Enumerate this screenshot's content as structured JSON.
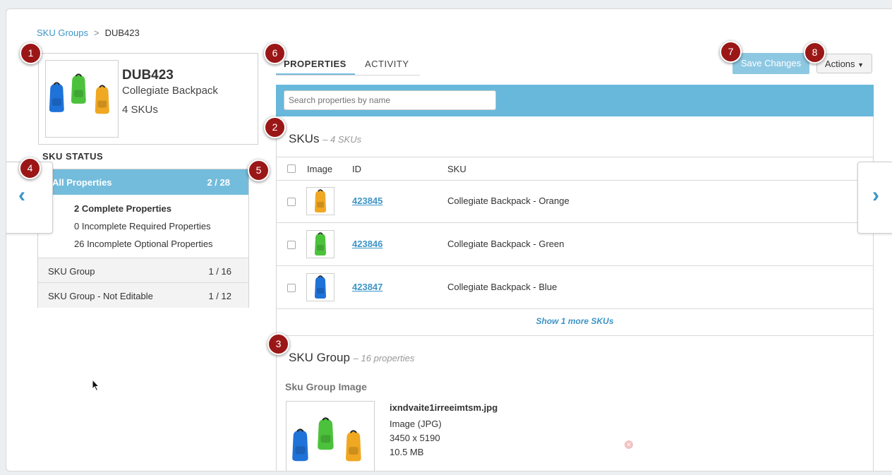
{
  "breadcrumb": {
    "parent": "SKU Groups",
    "separator": ">",
    "current": "DUB423"
  },
  "product": {
    "id": "DUB423",
    "name": "Collegiate Backpack",
    "sku_count": "4 SKUs"
  },
  "sku_status": {
    "title": "SKU STATUS",
    "all_properties": {
      "label": "All Properties",
      "value": "2 / 28"
    },
    "details": [
      "2 Complete Properties",
      "0 Incomplete Required Properties",
      "26 Incomplete Optional Properties"
    ],
    "groups": [
      {
        "label": "SKU Group",
        "value": "1 / 16"
      },
      {
        "label": "SKU Group - Not Editable",
        "value": "1 / 12"
      }
    ]
  },
  "tabs": [
    "PROPERTIES",
    "ACTIVITY"
  ],
  "toolbar": {
    "save_label": "Save Changes",
    "actions_label": "Actions"
  },
  "search": {
    "placeholder": "Search properties by name"
  },
  "skus_section": {
    "title": "SKUs",
    "meta": "– 4 SKUs",
    "columns": [
      "Image",
      "ID",
      "SKU"
    ],
    "rows": [
      {
        "id": "423845",
        "name": "Collegiate Backpack - Orange",
        "color": "orange"
      },
      {
        "id": "423846",
        "name": "Collegiate Backpack - Green",
        "color": "green"
      },
      {
        "id": "423847",
        "name": "Collegiate Backpack - Blue",
        "color": "blue"
      }
    ],
    "show_more": "Show 1 more SKUs"
  },
  "sku_group_section": {
    "title": "SKU Group",
    "meta": "– 16 properties",
    "field_label": "Sku Group Image",
    "file": {
      "name": "ixndvaite1irreeimtsm.jpg",
      "type": "Image (JPG)",
      "dimensions": "3450 x 5190",
      "size": "10.5 MB"
    }
  },
  "markers": [
    "1",
    "2",
    "3",
    "4",
    "5",
    "6",
    "7",
    "8"
  ],
  "colors": {
    "accent": "#68b8dc",
    "link": "#3d95c7",
    "marker": "#9b1717",
    "orange": "#f0a722",
    "green": "#4cc23c",
    "blue": "#1f72d8"
  }
}
